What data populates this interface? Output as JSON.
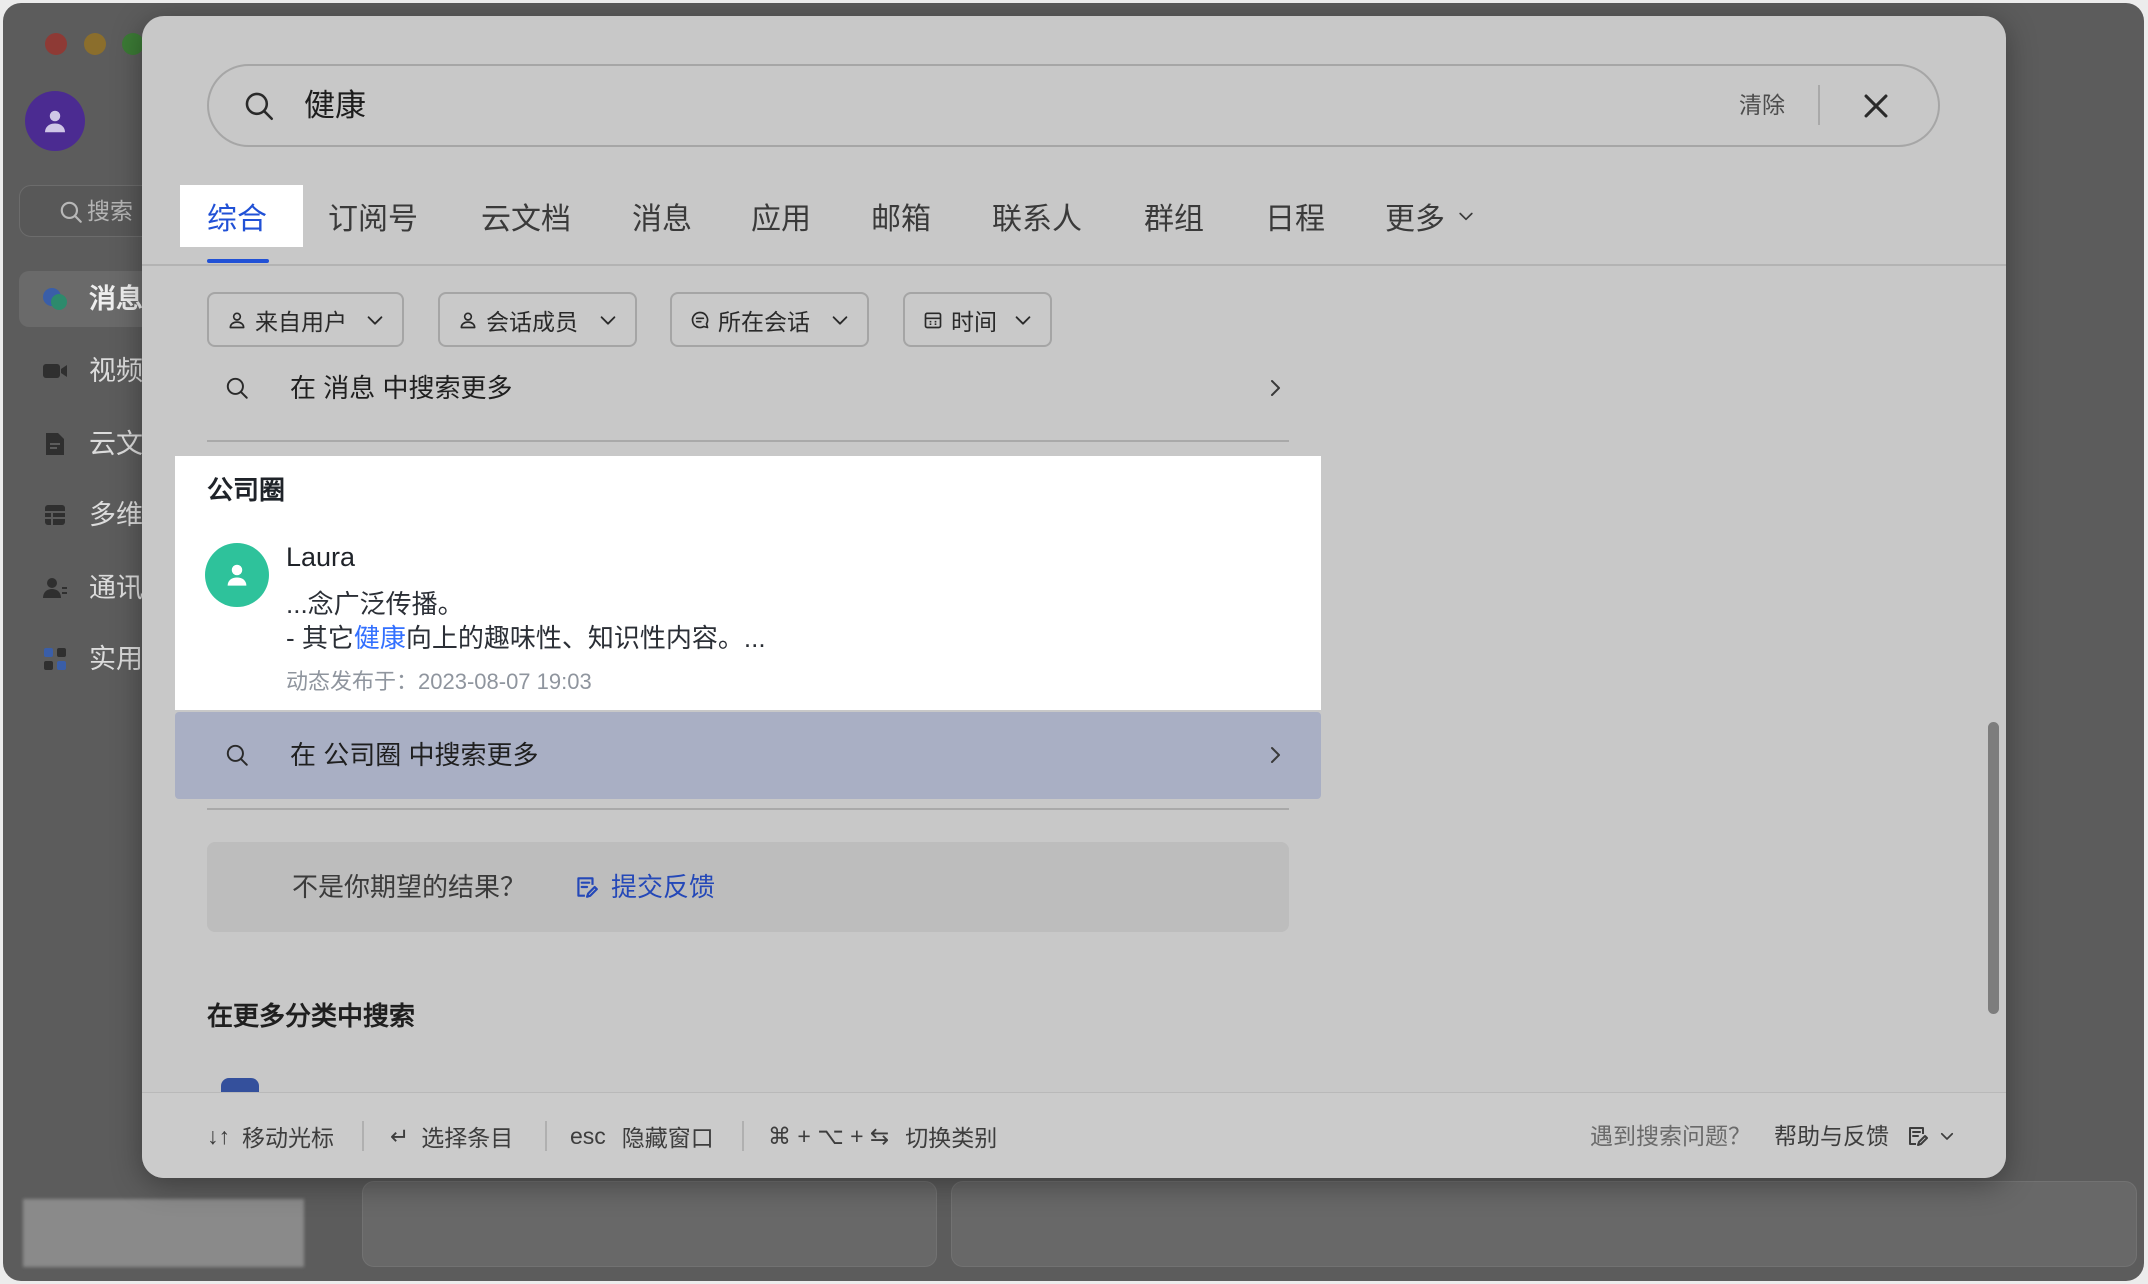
{
  "window": {
    "sidebar": {
      "search_placeholder": "搜索",
      "items": [
        {
          "label": "消息",
          "icon": "chat-bubble-icon",
          "active": true
        },
        {
          "label": "视频",
          "icon": "video-camera-icon"
        },
        {
          "label": "云文",
          "icon": "cloud-doc-icon"
        },
        {
          "label": "多维",
          "icon": "table-icon"
        },
        {
          "label": "通讯",
          "icon": "contacts-icon"
        },
        {
          "label": "实用",
          "icon": "apps-icon"
        }
      ]
    }
  },
  "search": {
    "query": "健康",
    "clear_label": "清除",
    "search_icon": "search-icon",
    "close_icon": "close-icon"
  },
  "tabs": [
    {
      "label": "综合",
      "active": true
    },
    {
      "label": "订阅号"
    },
    {
      "label": "云文档"
    },
    {
      "label": "消息"
    },
    {
      "label": "应用"
    },
    {
      "label": "邮箱"
    },
    {
      "label": "联系人"
    },
    {
      "label": "群组"
    },
    {
      "label": "日程"
    },
    {
      "label": "更多",
      "icon": "chevron-down-icon"
    }
  ],
  "filters": [
    {
      "label": "来自用户",
      "icon": "person-icon"
    },
    {
      "label": "会话成员",
      "icon": "person-icon"
    },
    {
      "label": "所在会话",
      "icon": "chat-icon"
    },
    {
      "label": "时间",
      "icon": "calendar-icon"
    }
  ],
  "messages_section": {
    "search_more": "在 消息 中搜索更多"
  },
  "moments_section": {
    "title": "公司圈",
    "result": {
      "author": "Laura",
      "line1": "...念广泛传播。",
      "line2_prefix": "- 其它",
      "line2_highlight": "健康",
      "line2_suffix": "向上的趣味性、知识性内容。...",
      "meta": "动态发布于：2023-08-07 19:03"
    },
    "search_more": "在 公司圈 中搜索更多"
  },
  "feedback": {
    "prompt": "不是你期望的结果？",
    "link_label": "提交反馈",
    "icon": "feedback-icon"
  },
  "more_categories": {
    "title": "在更多分类中搜索"
  },
  "footer": {
    "shortcuts": [
      {
        "keys": "↓↑",
        "label": "移动光标"
      },
      {
        "keys": "↵",
        "label": "选择条目"
      },
      {
        "keys": "esc",
        "label": "隐藏窗口"
      },
      {
        "keys": "⌘ + ⌥ + ⇆",
        "label": "切换类别"
      }
    ],
    "help_prompt": "遇到搜索问题？",
    "help_label": "帮助与反馈"
  },
  "colors": {
    "accent": "#2151d6",
    "link": "#2448b8",
    "highlight_row": "#a9afc4",
    "avatar": "#2ec29b",
    "user_avatar": "#4b2b91"
  }
}
